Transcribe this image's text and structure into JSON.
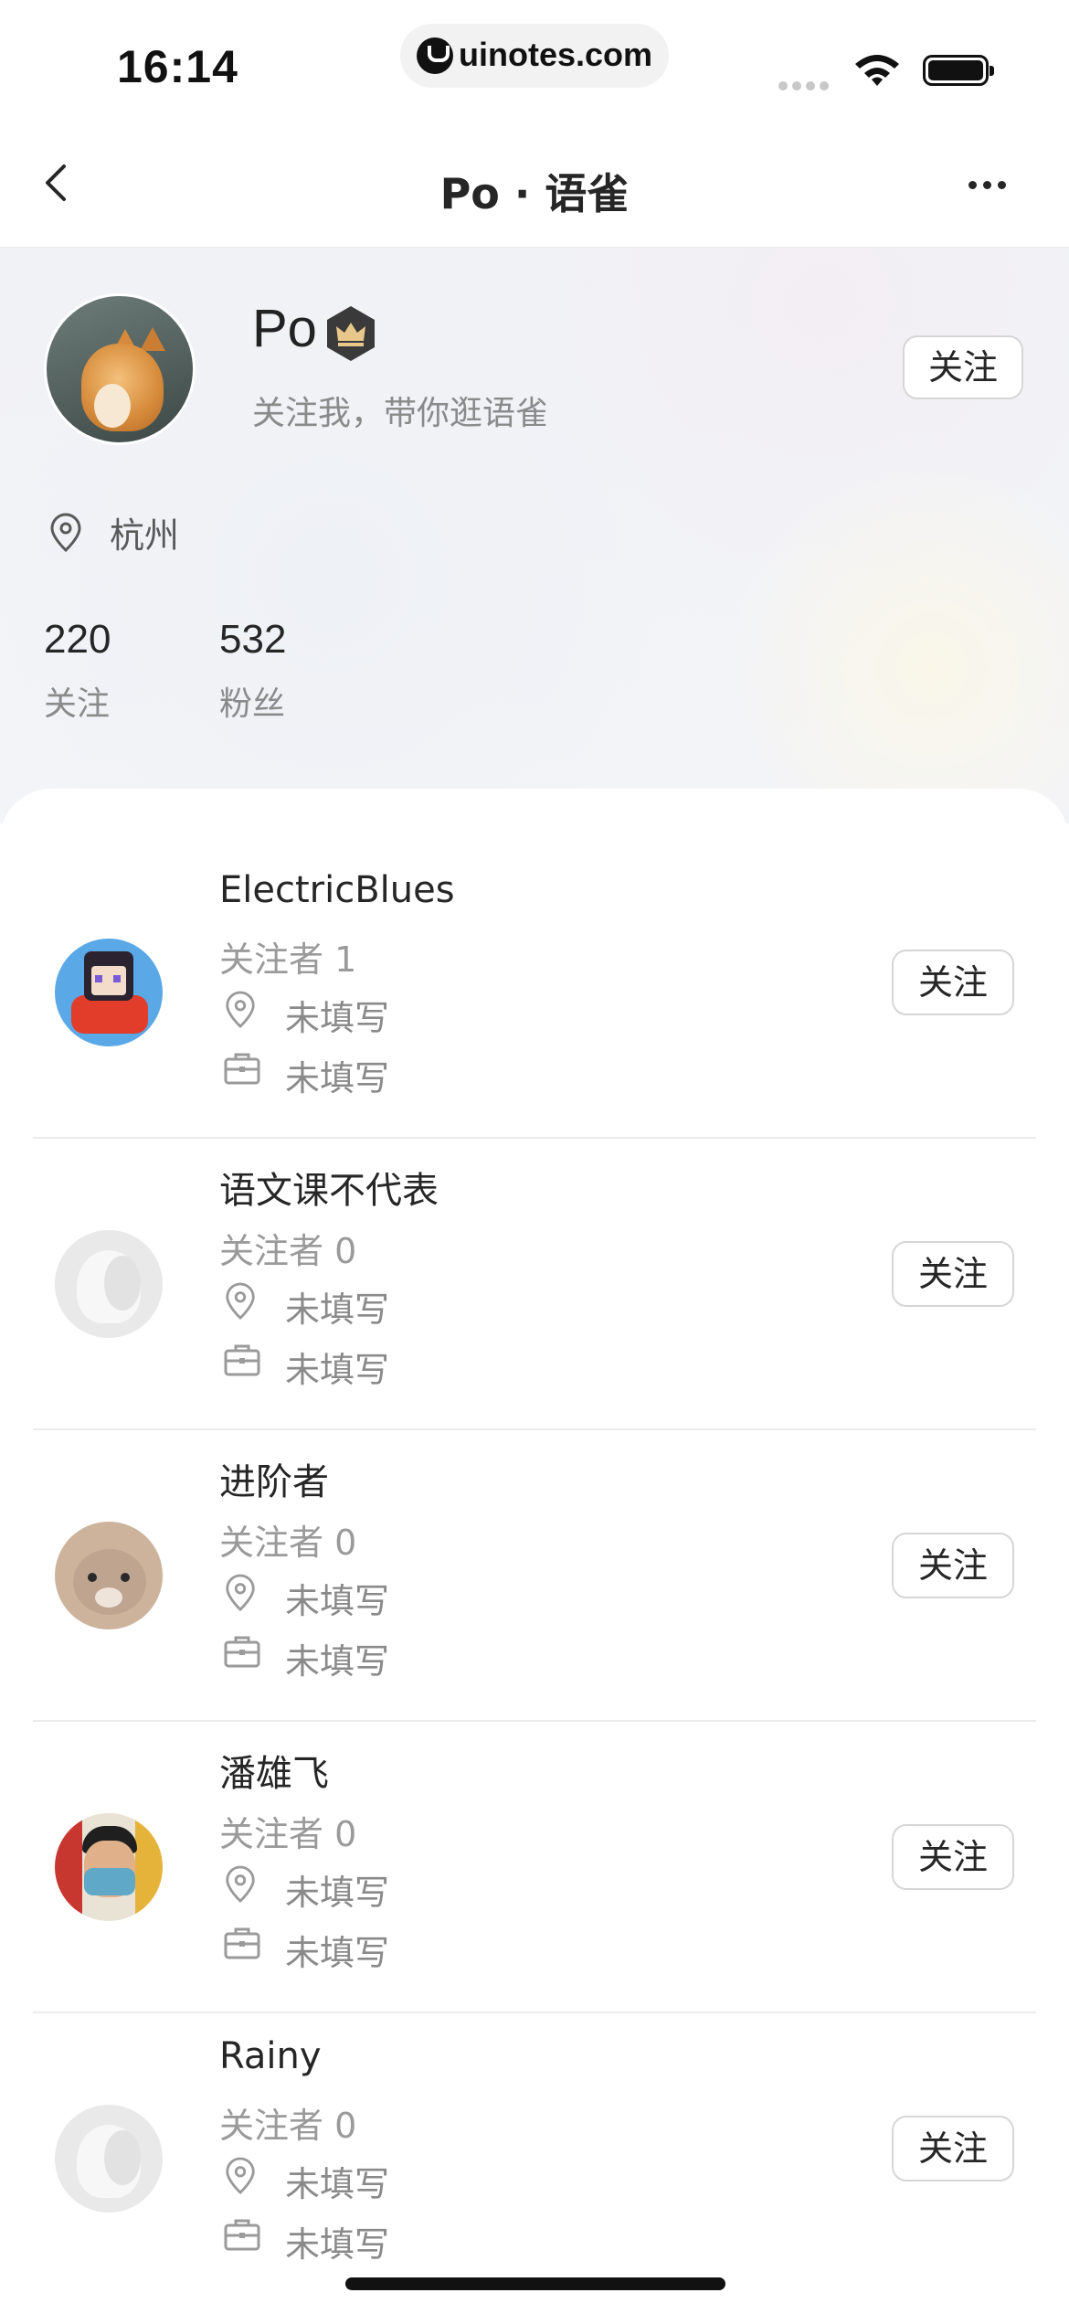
{
  "status_bar": {
    "time": "16:14",
    "url": "uinotes.com"
  },
  "nav": {
    "title": "Po · 语雀"
  },
  "profile": {
    "name": "Po",
    "bio": "关注我，带你逛语雀",
    "follow_label": "关注",
    "location": "杭州",
    "stats": [
      {
        "value": "220",
        "label": "关注"
      },
      {
        "value": "532",
        "label": "粉丝"
      }
    ]
  },
  "list": {
    "items": [
      {
        "name": "ElectricBlues",
        "followers": "关注者 1",
        "location": "未填写",
        "job": "未填写",
        "button": "关注"
      },
      {
        "name": "语文课不代表",
        "followers": "关注者 0",
        "location": "未填写",
        "job": "未填写",
        "button": "关注"
      },
      {
        "name": "进阶者",
        "followers": "关注者 0",
        "location": "未填写",
        "job": "未填写",
        "button": "关注"
      },
      {
        "name": "潘雄飞",
        "followers": "关注者 0",
        "location": "未填写",
        "job": "未填写",
        "button": "关注"
      },
      {
        "name": "Rainy",
        "followers": "关注者 0",
        "location": "未填写",
        "job": "未填写",
        "button": "关注"
      }
    ]
  },
  "icons": {
    "back": "chevron-left-icon",
    "more": "more-horizontal-icon",
    "location": "location-pin-icon",
    "job": "briefcase-icon",
    "badge": "crown-icon"
  },
  "colors": {
    "text_primary": "#262626",
    "text_secondary": "#8a8a8a",
    "border": "#d6d6d6"
  }
}
